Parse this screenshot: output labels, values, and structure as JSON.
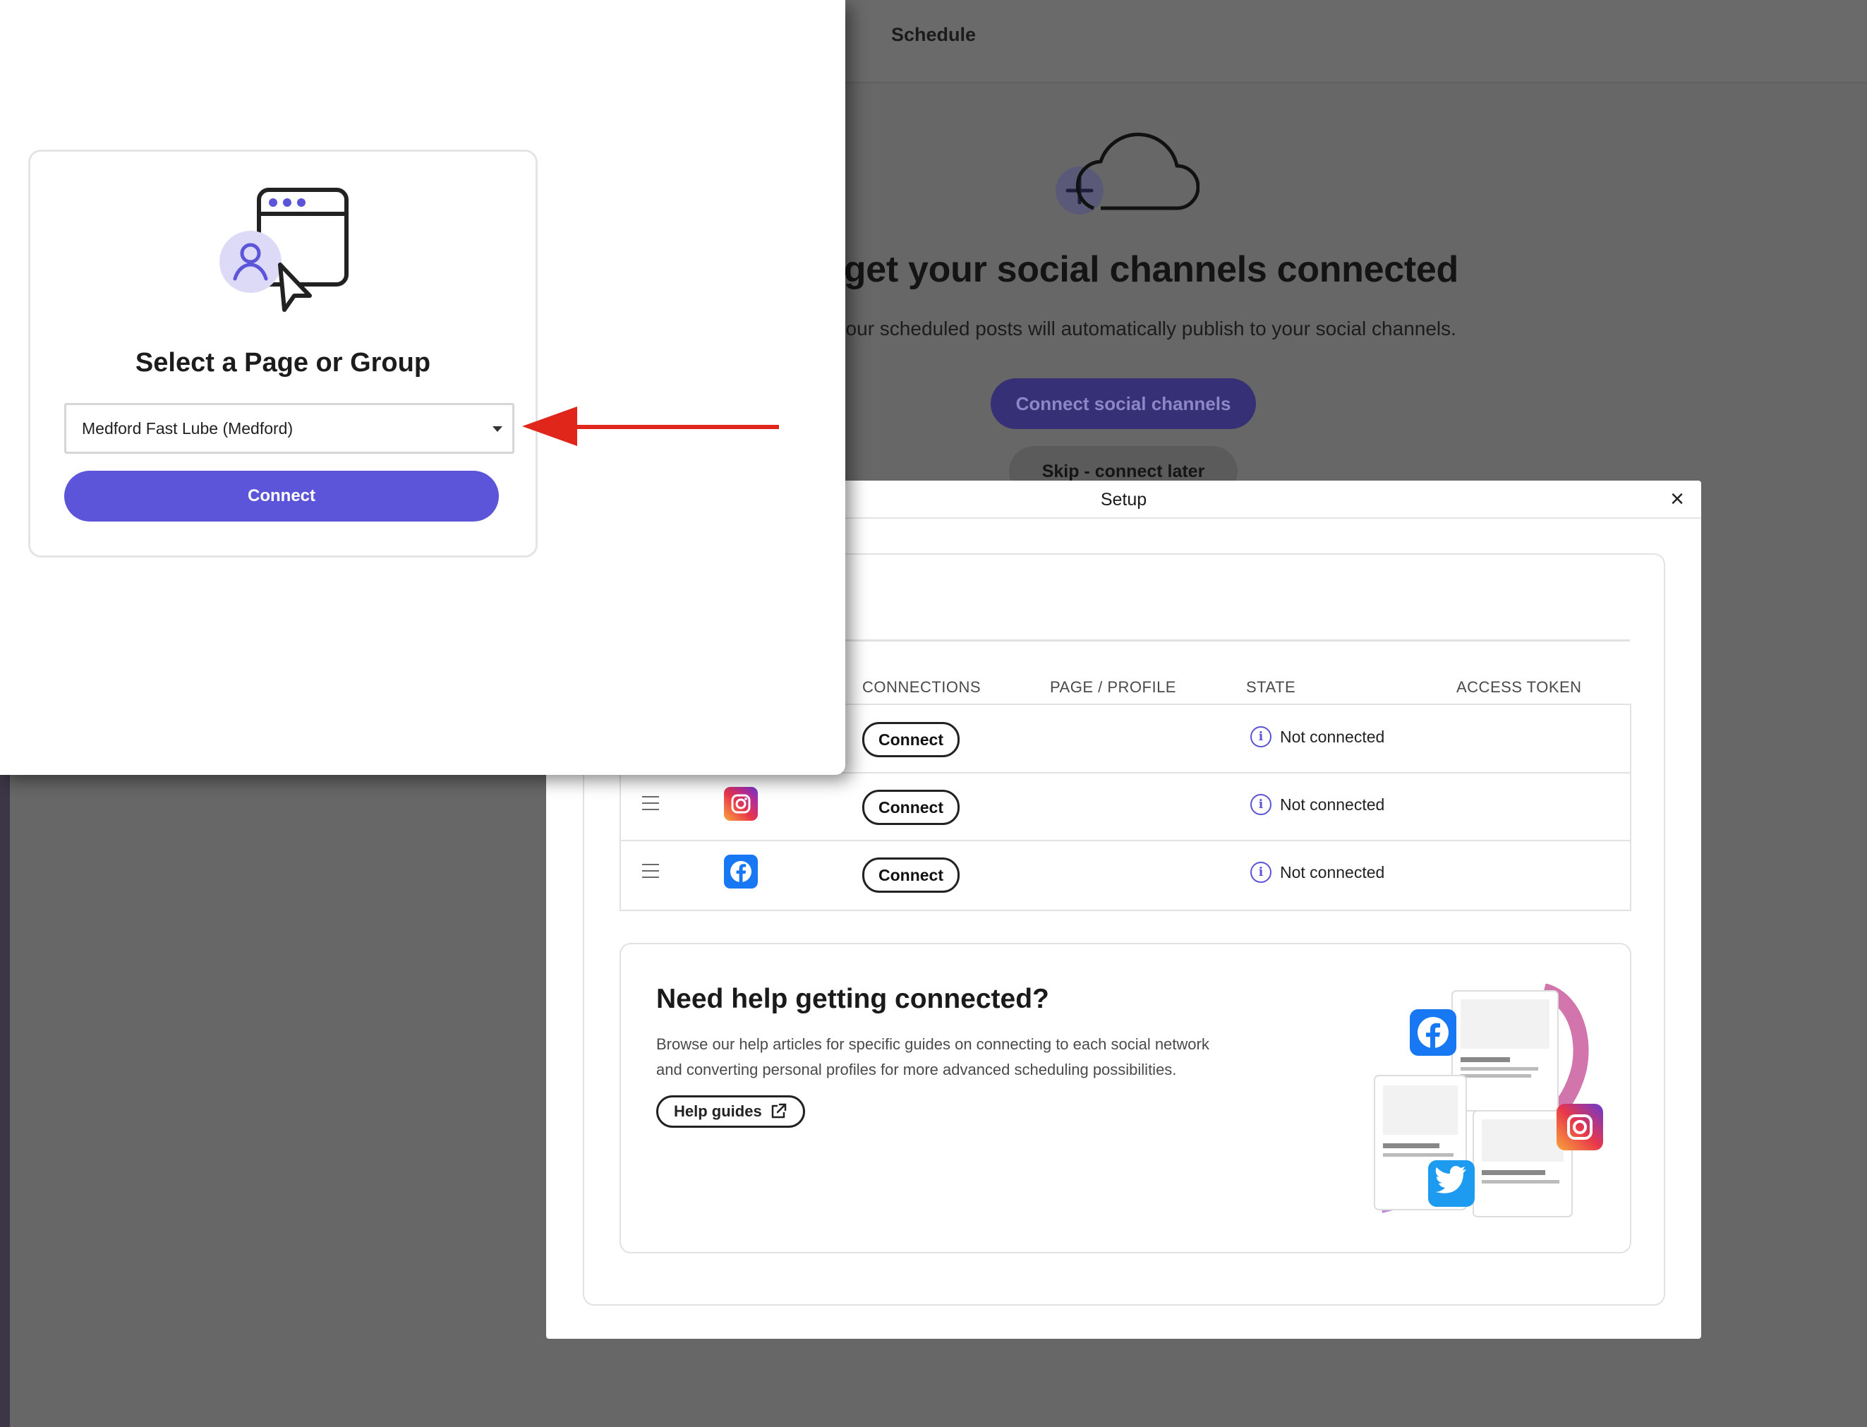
{
  "app": {
    "header_title": "Schedule",
    "heading": "s get your social channels connected",
    "subheading": "cted, your scheduled posts will automatically publish to your social channels.",
    "connect_channels_label": "Connect social channels",
    "skip_label": "Skip - connect later"
  },
  "setup_modal": {
    "title": "Setup",
    "close_icon": "close-icon",
    "columns": [
      "CONNECTIONS",
      "PAGE / PROFILE",
      "STATE",
      "ACCESS TOKEN"
    ],
    "rows": [
      {
        "network": "",
        "connect_label": "Connect",
        "state": "Not connected"
      },
      {
        "network": "instagram-icon",
        "connect_label": "Connect",
        "state": "Not connected"
      },
      {
        "network": "facebook-icon",
        "connect_label": "Connect",
        "state": "Not connected"
      }
    ],
    "help": {
      "title": "Need help getting connected?",
      "text": "Browse our help articles for specific guides on connecting to each social network and converting personal profiles for more advanced scheduling possibilities.",
      "button_label": "Help guides"
    }
  },
  "popup": {
    "title": "Select a Page or Group",
    "selected_page": "Medford Fast Lube (Medford)",
    "connect_label": "Connect"
  },
  "colors": {
    "accent": "#5c55d9",
    "arrow": "#e0261b",
    "overlay": "#676767",
    "facebook": "#1877f2"
  }
}
